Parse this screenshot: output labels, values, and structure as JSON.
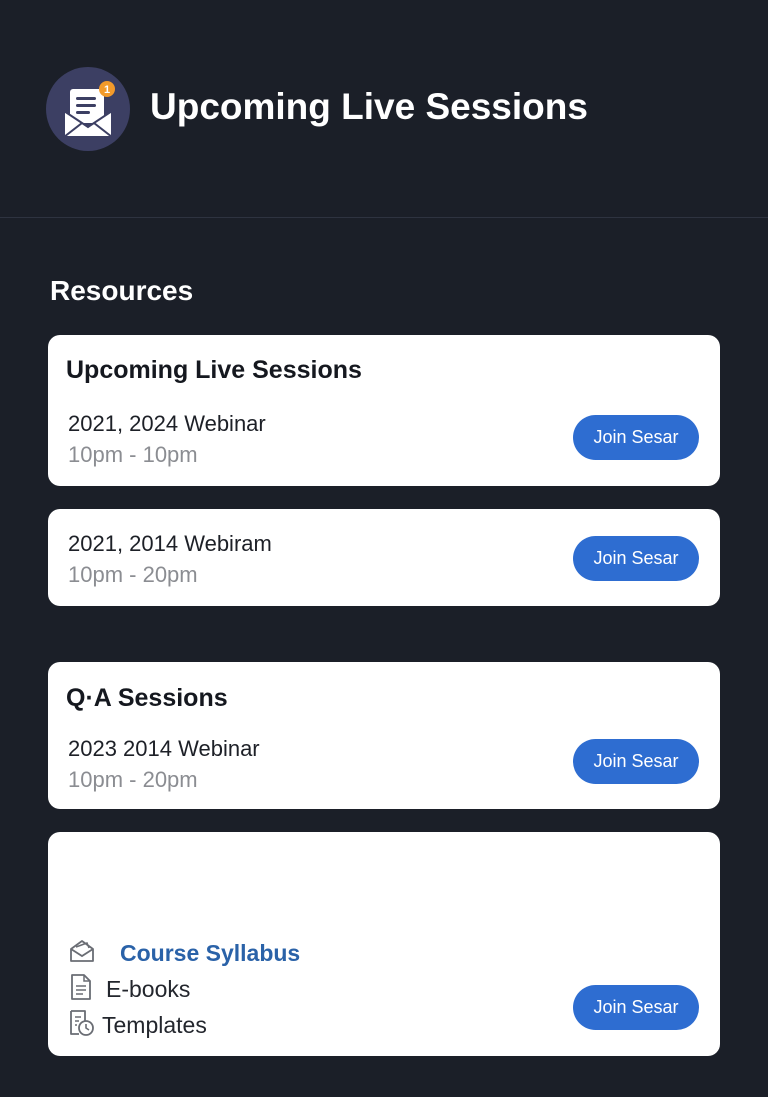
{
  "header": {
    "title": "Upcoming Live Sessions",
    "icon": "mail-notification-icon",
    "badge": "1"
  },
  "section_title": "Resources",
  "cards": [
    {
      "title": "Upcoming Live Sessions",
      "line1": "2021, 2024 Webinar",
      "line2": "10pm - 10pm",
      "button": "Join Sesar"
    },
    {
      "line1": "2021, 2014  Webiram",
      "line2": "10pm - 20pm",
      "button": "Join Sesar"
    },
    {
      "title": "Q·A Sessions",
      "line1": "2023 2014 Webinar",
      "line2": "10pm - 20pm",
      "button": "Join Sesar"
    }
  ],
  "resources": {
    "items": [
      {
        "label": "Course Syllabus",
        "icon": "open-envelope-icon"
      },
      {
        "label": "E-books",
        "icon": "document-icon"
      },
      {
        "label": "Templates",
        "icon": "template-clock-icon"
      }
    ],
    "button": "Join Sesar"
  },
  "colors": {
    "background": "#1b1f28",
    "card": "#ffffff",
    "accent": "#2e6dd1",
    "link": "#2a62a8",
    "icon_circle": "#3c3f63",
    "badge": "#f39a2b"
  }
}
